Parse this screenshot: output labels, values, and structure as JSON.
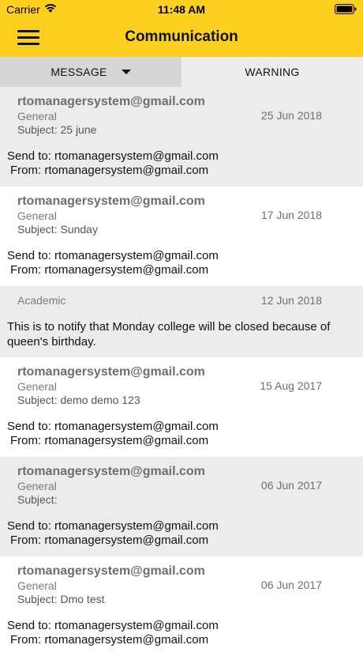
{
  "status": {
    "carrier": "Carrier",
    "time": "11:48 AM"
  },
  "header": {
    "title": "Communication"
  },
  "tabs": {
    "message": "MESSAGE",
    "warning": "WARNING"
  },
  "items": [
    {
      "sender": "rtomanagersystem@gmail.com",
      "category": "General",
      "subject": "Subject: 25 june",
      "date": "25 Jun 2018",
      "send_to": "Send to: rtomanagersystem@gmail.com",
      "from": "From: rtomanagersystem@gmail.com"
    },
    {
      "sender": "rtomanagersystem@gmail.com",
      "category": "General",
      "subject": "Subject: Sunday",
      "date": "17 Jun 2018",
      "send_to": "Send to: rtomanagersystem@gmail.com",
      "from": "From: rtomanagersystem@gmail.com"
    },
    {
      "category": "Academic",
      "date": "12 Jun 2018",
      "body": "This is to notify that Monday college will be closed because of queen's birthday."
    },
    {
      "sender": "rtomanagersystem@gmail.com",
      "category": "General",
      "subject": "Subject: demo demo 123",
      "date": "15 Aug 2017",
      "send_to": "Send to: rtomanagersystem@gmail.com",
      "from": "From: rtomanagersystem@gmail.com"
    },
    {
      "sender": "rtomanagersystem@gmail.com",
      "category": "General",
      "subject": "Subject:",
      "date": "06 Jun 2017",
      "send_to": "Send to: rtomanagersystem@gmail.com",
      "from": "From: rtomanagersystem@gmail.com"
    },
    {
      "sender": "rtomanagersystem@gmail.com",
      "category": "General",
      "subject": "Subject: Dmo test",
      "date": "06 Jun 2017",
      "send_to": "Send to: rtomanagersystem@gmail.com",
      "from": "From: rtomanagersystem@gmail.com"
    }
  ]
}
